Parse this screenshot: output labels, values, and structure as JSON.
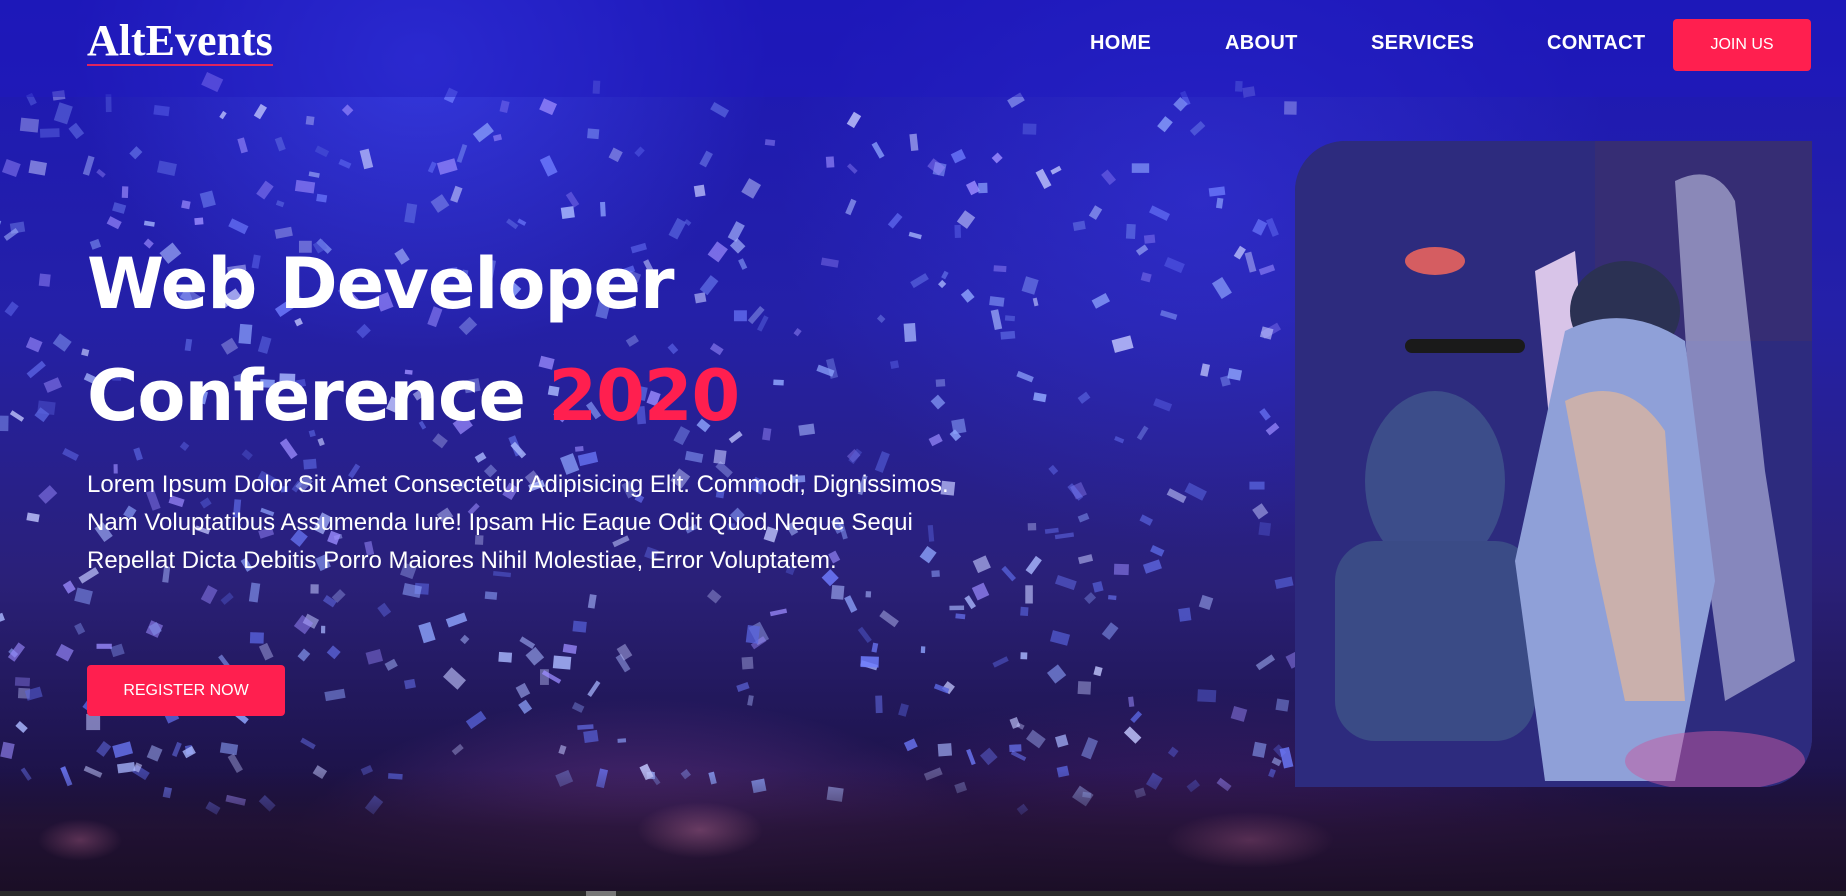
{
  "brand": {
    "logo_text": "AltEvents"
  },
  "nav": {
    "items": [
      {
        "label": "HOME"
      },
      {
        "label": "ABOUT"
      },
      {
        "label": "SERVICES"
      },
      {
        "label": "CONTACT"
      }
    ],
    "cta_label": "JOIN US"
  },
  "hero": {
    "title_line1": "Web Developer",
    "title_line2_prefix": "Conference",
    "title_year": "2020",
    "description": "Lorem Ipsum Dolor Sit Amet Consectetur Adipisicing Elit. Commodi, Dignissimos. Nam Voluptatibus Assumenda Iure! Ipsam Hic Eaque Odit Quod Neque Sequi Repellat Dicta Debitis Porro Maiores Nihil Molestiae, Error Voluptatem.",
    "register_label": "REGISTER NOW",
    "image_icon": "singer-photo-icon"
  },
  "colors": {
    "accent": "#ff1f4f",
    "background": "#1d18b5",
    "text": "#ffffff"
  }
}
